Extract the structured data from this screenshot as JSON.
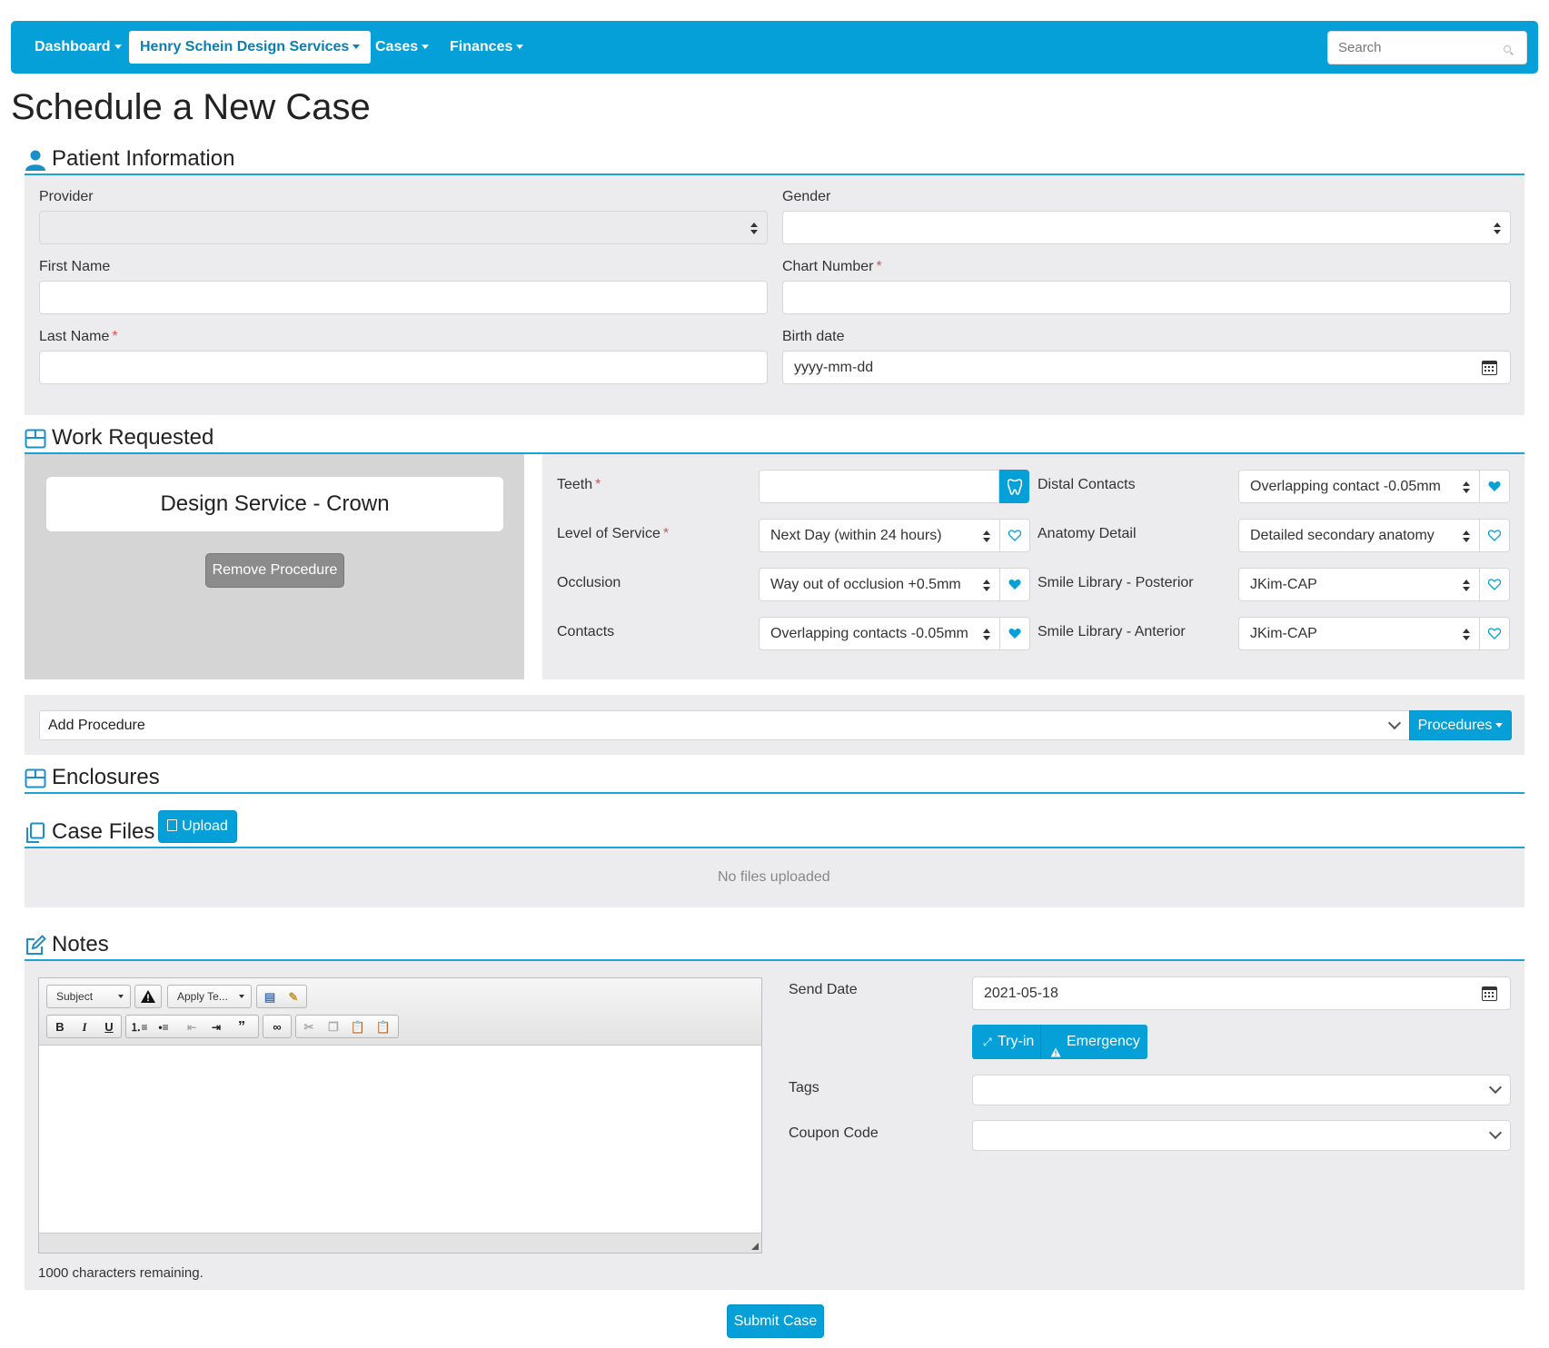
{
  "nav": {
    "items": [
      {
        "label": "Dashboard",
        "active": false
      },
      {
        "label": "Henry Schein Design Services",
        "active": true
      },
      {
        "label": "Cases",
        "active": false
      },
      {
        "label": "Finances",
        "active": false
      }
    ],
    "search_placeholder": "Search"
  },
  "page": {
    "title": "Schedule a New Case"
  },
  "sections": {
    "patient_info": "Patient Information",
    "work_requested": "Work Requested",
    "enclosures": "Enclosures",
    "case_files": "Case Files",
    "notes": "Notes"
  },
  "patient": {
    "provider_label": "Provider",
    "provider_value": "",
    "gender_label": "Gender",
    "gender_value": "",
    "first_name_label": "First Name",
    "first_name_value": "",
    "chart_number_label": "Chart Number",
    "chart_number_value": "",
    "last_name_label": "Last Name",
    "last_name_value": "",
    "birth_date_label": "Birth date",
    "birth_date_placeholder": "yyyy-mm-dd",
    "required_mark": "*"
  },
  "work": {
    "procedure_title": "Design Service - Crown",
    "remove_button": "Remove Procedure",
    "teeth_label": "Teeth",
    "teeth_value": "",
    "level_label": "Level of Service",
    "level_value": "Next Day (within 24 hours)",
    "occlusion_label": "Occlusion",
    "occlusion_value": "Way out of occlusion +0.5mm",
    "contacts_label": "Contacts",
    "contacts_value": "Overlapping contacts -0.05mm",
    "distal_label": "Distal Contacts",
    "distal_value": "Overlapping contact -0.05mm",
    "anatomy_label": "Anatomy Detail",
    "anatomy_value": "Detailed secondary anatomy",
    "smile_post_label": "Smile Library - Posterior",
    "smile_post_value": "JKim-CAP",
    "smile_ant_label": "Smile Library - Anterior",
    "smile_ant_value": "JKim-CAP",
    "favorites": {
      "level": false,
      "occlusion": true,
      "contacts": true,
      "distal": true,
      "anatomy": false,
      "smile_post": false,
      "smile_ant": false
    }
  },
  "add_procedure": {
    "value": "Add Procedure",
    "button": "Procedures"
  },
  "case_files": {
    "upload_button": "Upload",
    "empty_text": "No files uploaded"
  },
  "notes": {
    "toolbar": {
      "subject": "Subject",
      "apply_template": "Apply Te..."
    },
    "chars_remaining": "1000 characters remaining.",
    "send_date_label": "Send Date",
    "send_date_value": "2021-05-18",
    "tryin_button": "Try-in",
    "emergency_button": "Emergency",
    "tags_label": "Tags",
    "tags_value": "",
    "coupon_label": "Coupon Code",
    "coupon_value": ""
  },
  "submit_button": "Submit Case",
  "colors": {
    "brand": "#05a0d8",
    "required": "#d9534f",
    "panel": "#ececee"
  }
}
